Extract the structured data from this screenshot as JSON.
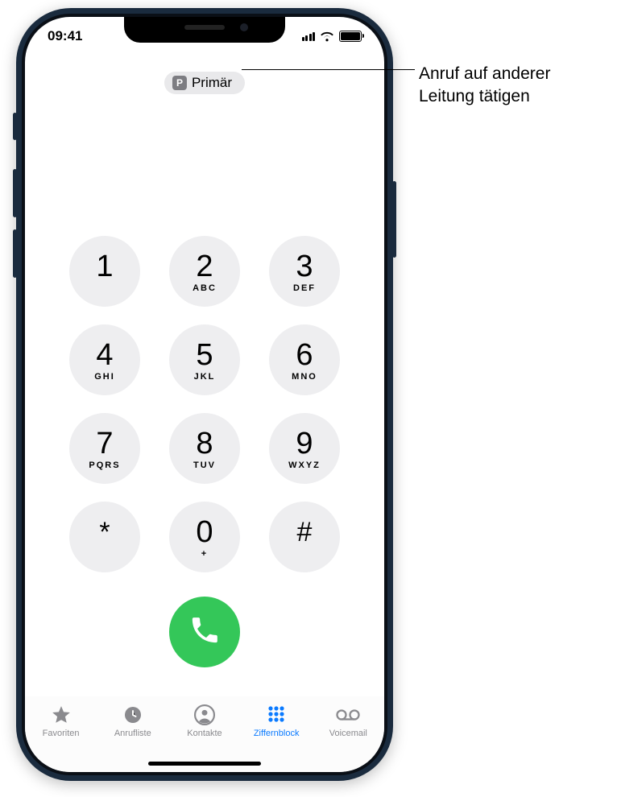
{
  "status": {
    "time": "09:41"
  },
  "line_selector": {
    "badge": "P",
    "label": "Primär"
  },
  "keypad": [
    {
      "digit": "1",
      "letters": ""
    },
    {
      "digit": "2",
      "letters": "ABC"
    },
    {
      "digit": "3",
      "letters": "DEF"
    },
    {
      "digit": "4",
      "letters": "GHI"
    },
    {
      "digit": "5",
      "letters": "JKL"
    },
    {
      "digit": "6",
      "letters": "MNO"
    },
    {
      "digit": "7",
      "letters": "PQRS"
    },
    {
      "digit": "8",
      "letters": "TUV"
    },
    {
      "digit": "9",
      "letters": "WXYZ"
    },
    {
      "digit": "*",
      "letters": ""
    },
    {
      "digit": "0",
      "letters": "+"
    },
    {
      "digit": "#",
      "letters": ""
    }
  ],
  "tabs": [
    {
      "label": "Favoriten",
      "active": false
    },
    {
      "label": "Anrufliste",
      "active": false
    },
    {
      "label": "Kontakte",
      "active": false
    },
    {
      "label": "Ziffernblock",
      "active": true
    },
    {
      "label": "Voicemail",
      "active": false
    }
  ],
  "callout": {
    "line1": "Anruf auf anderer",
    "line2": "Leitung tätigen"
  },
  "colors": {
    "dial_green": "#34c759",
    "accent_blue": "#0a7aff",
    "key_bg": "#eeeef0",
    "pill_bg": "#e9e9eb",
    "tab_inactive": "#8a8a8e"
  }
}
